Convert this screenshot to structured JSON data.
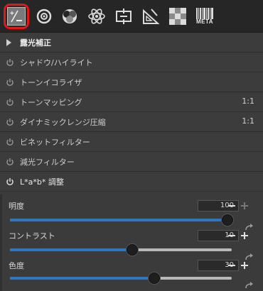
{
  "toolbar": {
    "tools": [
      {
        "name": "exposure-tool",
        "icon": "exposure-plus-minus-icon"
      },
      {
        "name": "lens-tool",
        "icon": "lens-ring-icon"
      },
      {
        "name": "color-tool",
        "icon": "color-circles-icon"
      },
      {
        "name": "detail-tool",
        "icon": "atom-icon"
      },
      {
        "name": "crop-tool",
        "icon": "crop-frame-icon"
      },
      {
        "name": "geometry-tool",
        "icon": "ruler-triangle-icon"
      },
      {
        "name": "local-tool",
        "icon": "checker-icon"
      },
      {
        "name": "metadata-tool",
        "icon": "barcode-icon"
      }
    ],
    "meta_label": "META"
  },
  "panel": {
    "header": "露光補正",
    "rows": [
      {
        "label": "シャドウ/ハイライト",
        "value": ""
      },
      {
        "label": "トーンイコライザ",
        "value": ""
      },
      {
        "label": "トーンマッピング",
        "value": "1:1"
      },
      {
        "label": "ダイナミックレンジ圧縮",
        "value": "1:1"
      },
      {
        "label": "ビネットフィルター",
        "value": ""
      },
      {
        "label": "減光フィルター",
        "value": ""
      },
      {
        "label": "L*a*b* 調整",
        "value": ""
      }
    ]
  },
  "lab": {
    "controls": [
      {
        "label": "明度",
        "value": "100",
        "position_fraction": 1.0,
        "plus_enabled": false
      },
      {
        "label": "コントラスト",
        "value": "10",
        "position_fraction": 0.55,
        "plus_enabled": true
      },
      {
        "label": "色度",
        "value": "30",
        "position_fraction": 0.65,
        "plus_enabled": true
      }
    ]
  },
  "colors": {
    "accent": "#2f76c0",
    "highlight": "#e01818"
  }
}
